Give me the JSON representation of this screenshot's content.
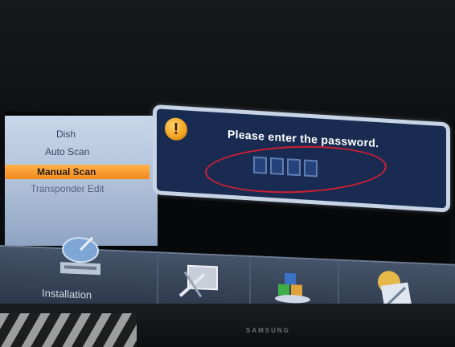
{
  "menu": {
    "items": [
      {
        "label": "Dish"
      },
      {
        "label": "Auto Scan"
      },
      {
        "label": "Manual Scan",
        "selected": true
      },
      {
        "label": "Transponder Edit"
      }
    ]
  },
  "dialog": {
    "message": "Please enter the password.",
    "icon": "warning-icon",
    "password_boxes": 4
  },
  "icon_bar": {
    "label": "Installation",
    "tiles": [
      {
        "icon": "satellite-dish-icon"
      },
      {
        "icon": "system-setup-icon"
      },
      {
        "icon": "multimedia-blocks-icon"
      },
      {
        "icon": "tools-icon"
      }
    ]
  },
  "tv": {
    "brand": "SAMSUNG"
  },
  "colors": {
    "menu_highlight": "#f28a1c",
    "dialog_background": "#1a2b52",
    "annotation_ellipse": "#d21f34"
  }
}
